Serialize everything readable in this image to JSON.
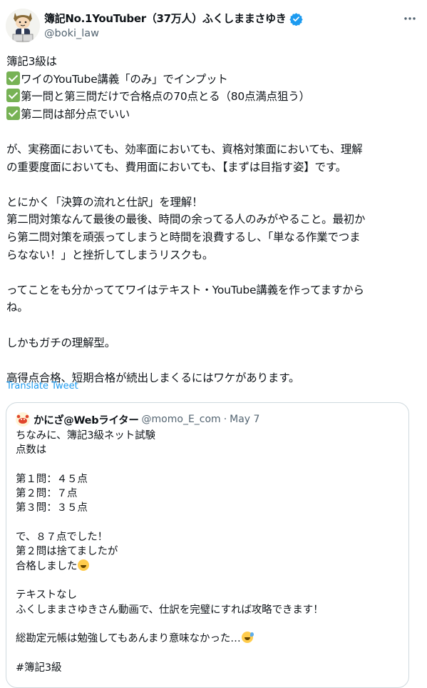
{
  "author": {
    "display_name": "簿記No.1YouTuber（37万人）ふくしままさゆき",
    "handle": "@boki_law",
    "avatar_icon": "cartoon-avatar-icon",
    "verified_icon": "verified-badge-icon"
  },
  "tweet": {
    "lines": [
      "簿記3級は",
      "ワイのYouTube講義「のみ」でインプット",
      "第一問と第三問だけで合格点の70点とる（80点満点狙う）",
      "第二問は部分点でいい",
      "が、実務面においても、効率面においても、資格対策面においても、理解",
      "の重要度面においても、費用面においても、【まずは目指す姿】です。",
      "とにかく「決算の流れと仕訳」を理解！",
      "第二問対策なんて最後の最後、時間の余ってる人のみがやること。最初か",
      "ら第二問対策を頑張ってしまうと時間を浪費するし、「単なる作業でつま",
      "らなない！」と挫折してしまうリスクも。",
      "ってことをも分かっててワイはテキスト・YouTube講義を作ってますから",
      "ね。",
      "しかもガチの理解型。",
      "高得点合格、短期合格が続出しまくるにはワケがあります。"
    ],
    "translate_label": "Translate Tweet"
  },
  "quoted": {
    "display_name": "かにざ@Webライター",
    "handle": "@momo_E_com",
    "separator": "·",
    "date": "May 7",
    "lines": [
      "ちなみに、簿記3級ネット試験",
      "点数は",
      "第１問：４５点",
      "第２問：７点",
      "第３問：３５点",
      "で、８７点でした！",
      "第２問は捨てましたが",
      "合格しました",
      "テキストなし",
      "ふくしままさゆきさん動画で、仕訳を完璧にすれば攻略できます！",
      "総勘定元帳は勉強してもあんまり意味なかった…",
      "#簿記3級"
    ]
  },
  "colors": {
    "text": "#0f1419",
    "secondary": "#536471",
    "link": "#1d9bf0",
    "border": "#cfd9de",
    "check": "#77b255"
  }
}
